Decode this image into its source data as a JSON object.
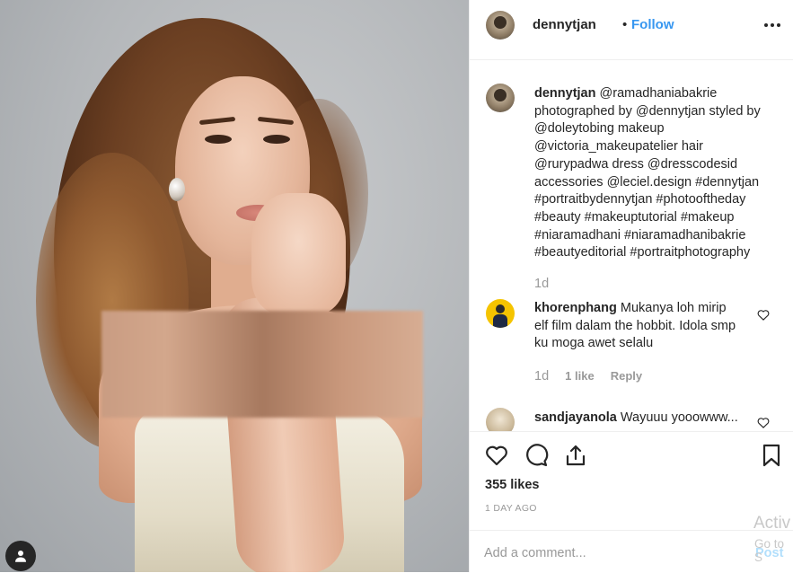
{
  "post": {
    "username": "dennytjan",
    "separator": "•",
    "follow_label": "Follow",
    "more_icon": "ellipsis-icon"
  },
  "caption": {
    "username": "dennytjan",
    "text": "@ramadhaniabakrie photographed by @dennytjan styled by @doleytobing makeup @victoria_makeupatelier hair @rurypadwa dress @dresscodesid accessories @leciel.design #dennytjan #portraitbydennytjan #photooftheday #beauty #makeuptutorial #makeup #niaramadhani #niaramadhanibakrie #beautyeditorial #portraitphotography",
    "time": "1d"
  },
  "comments": [
    {
      "username": "khorenphang",
      "text": "Mukanya loh mirip elf film dalam the hobbit. Idola smp ku moga awet selalu",
      "time": "1d",
      "likes": "1 like",
      "reply_label": "Reply"
    },
    {
      "username": "sandjayanola",
      "text": "Wayuuu yooowww..."
    }
  ],
  "actions": {
    "like_icon": "heart-icon",
    "comment_icon": "comment-icon",
    "share_icon": "share-icon",
    "save_icon": "bookmark-icon"
  },
  "likes_text": "355 likes",
  "posted_time": "1 DAY AGO",
  "add_comment": {
    "placeholder": "Add a comment...",
    "post_label": "Post"
  },
  "watermark": {
    "title": "Activ",
    "subtitle": "Go to S"
  },
  "colors": {
    "link": "#3897f0",
    "post_disabled": "#b2dffc",
    "muted": "#999999",
    "text": "#262626"
  }
}
